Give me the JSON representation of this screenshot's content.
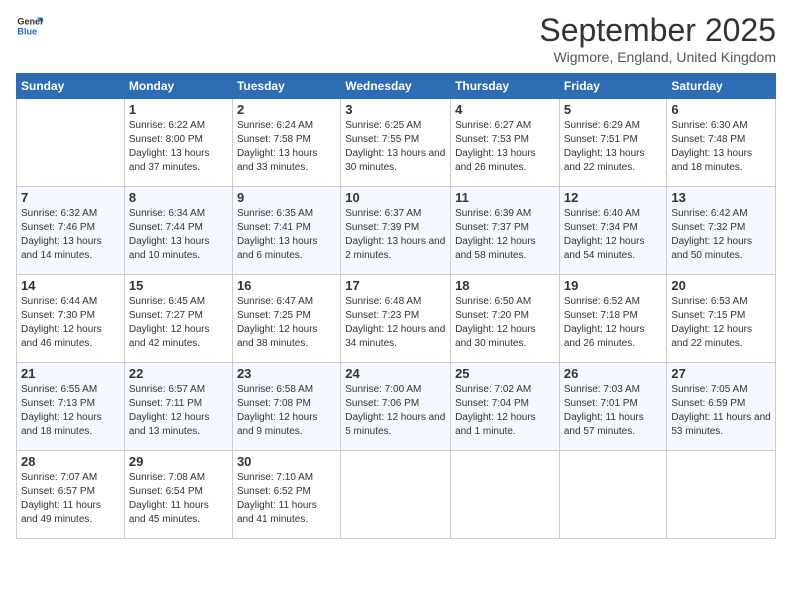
{
  "logo": {
    "line1": "General",
    "line2": "Blue"
  },
  "title": "September 2025",
  "location": "Wigmore, England, United Kingdom",
  "days": [
    "Sunday",
    "Monday",
    "Tuesday",
    "Wednesday",
    "Thursday",
    "Friday",
    "Saturday"
  ],
  "weeks": [
    [
      {
        "date": "",
        "sunrise": "",
        "sunset": "",
        "daylight": ""
      },
      {
        "date": "1",
        "sunrise": "Sunrise: 6:22 AM",
        "sunset": "Sunset: 8:00 PM",
        "daylight": "Daylight: 13 hours and 37 minutes."
      },
      {
        "date": "2",
        "sunrise": "Sunrise: 6:24 AM",
        "sunset": "Sunset: 7:58 PM",
        "daylight": "Daylight: 13 hours and 33 minutes."
      },
      {
        "date": "3",
        "sunrise": "Sunrise: 6:25 AM",
        "sunset": "Sunset: 7:55 PM",
        "daylight": "Daylight: 13 hours and 30 minutes."
      },
      {
        "date": "4",
        "sunrise": "Sunrise: 6:27 AM",
        "sunset": "Sunset: 7:53 PM",
        "daylight": "Daylight: 13 hours and 26 minutes."
      },
      {
        "date": "5",
        "sunrise": "Sunrise: 6:29 AM",
        "sunset": "Sunset: 7:51 PM",
        "daylight": "Daylight: 13 hours and 22 minutes."
      },
      {
        "date": "6",
        "sunrise": "Sunrise: 6:30 AM",
        "sunset": "Sunset: 7:48 PM",
        "daylight": "Daylight: 13 hours and 18 minutes."
      }
    ],
    [
      {
        "date": "7",
        "sunrise": "Sunrise: 6:32 AM",
        "sunset": "Sunset: 7:46 PM",
        "daylight": "Daylight: 13 hours and 14 minutes."
      },
      {
        "date": "8",
        "sunrise": "Sunrise: 6:34 AM",
        "sunset": "Sunset: 7:44 PM",
        "daylight": "Daylight: 13 hours and 10 minutes."
      },
      {
        "date": "9",
        "sunrise": "Sunrise: 6:35 AM",
        "sunset": "Sunset: 7:41 PM",
        "daylight": "Daylight: 13 hours and 6 minutes."
      },
      {
        "date": "10",
        "sunrise": "Sunrise: 6:37 AM",
        "sunset": "Sunset: 7:39 PM",
        "daylight": "Daylight: 13 hours and 2 minutes."
      },
      {
        "date": "11",
        "sunrise": "Sunrise: 6:39 AM",
        "sunset": "Sunset: 7:37 PM",
        "daylight": "Daylight: 12 hours and 58 minutes."
      },
      {
        "date": "12",
        "sunrise": "Sunrise: 6:40 AM",
        "sunset": "Sunset: 7:34 PM",
        "daylight": "Daylight: 12 hours and 54 minutes."
      },
      {
        "date": "13",
        "sunrise": "Sunrise: 6:42 AM",
        "sunset": "Sunset: 7:32 PM",
        "daylight": "Daylight: 12 hours and 50 minutes."
      }
    ],
    [
      {
        "date": "14",
        "sunrise": "Sunrise: 6:44 AM",
        "sunset": "Sunset: 7:30 PM",
        "daylight": "Daylight: 12 hours and 46 minutes."
      },
      {
        "date": "15",
        "sunrise": "Sunrise: 6:45 AM",
        "sunset": "Sunset: 7:27 PM",
        "daylight": "Daylight: 12 hours and 42 minutes."
      },
      {
        "date": "16",
        "sunrise": "Sunrise: 6:47 AM",
        "sunset": "Sunset: 7:25 PM",
        "daylight": "Daylight: 12 hours and 38 minutes."
      },
      {
        "date": "17",
        "sunrise": "Sunrise: 6:48 AM",
        "sunset": "Sunset: 7:23 PM",
        "daylight": "Daylight: 12 hours and 34 minutes."
      },
      {
        "date": "18",
        "sunrise": "Sunrise: 6:50 AM",
        "sunset": "Sunset: 7:20 PM",
        "daylight": "Daylight: 12 hours and 30 minutes."
      },
      {
        "date": "19",
        "sunrise": "Sunrise: 6:52 AM",
        "sunset": "Sunset: 7:18 PM",
        "daylight": "Daylight: 12 hours and 26 minutes."
      },
      {
        "date": "20",
        "sunrise": "Sunrise: 6:53 AM",
        "sunset": "Sunset: 7:15 PM",
        "daylight": "Daylight: 12 hours and 22 minutes."
      }
    ],
    [
      {
        "date": "21",
        "sunrise": "Sunrise: 6:55 AM",
        "sunset": "Sunset: 7:13 PM",
        "daylight": "Daylight: 12 hours and 18 minutes."
      },
      {
        "date": "22",
        "sunrise": "Sunrise: 6:57 AM",
        "sunset": "Sunset: 7:11 PM",
        "daylight": "Daylight: 12 hours and 13 minutes."
      },
      {
        "date": "23",
        "sunrise": "Sunrise: 6:58 AM",
        "sunset": "Sunset: 7:08 PM",
        "daylight": "Daylight: 12 hours and 9 minutes."
      },
      {
        "date": "24",
        "sunrise": "Sunrise: 7:00 AM",
        "sunset": "Sunset: 7:06 PM",
        "daylight": "Daylight: 12 hours and 5 minutes."
      },
      {
        "date": "25",
        "sunrise": "Sunrise: 7:02 AM",
        "sunset": "Sunset: 7:04 PM",
        "daylight": "Daylight: 12 hours and 1 minute."
      },
      {
        "date": "26",
        "sunrise": "Sunrise: 7:03 AM",
        "sunset": "Sunset: 7:01 PM",
        "daylight": "Daylight: 11 hours and 57 minutes."
      },
      {
        "date": "27",
        "sunrise": "Sunrise: 7:05 AM",
        "sunset": "Sunset: 6:59 PM",
        "daylight": "Daylight: 11 hours and 53 minutes."
      }
    ],
    [
      {
        "date": "28",
        "sunrise": "Sunrise: 7:07 AM",
        "sunset": "Sunset: 6:57 PM",
        "daylight": "Daylight: 11 hours and 49 minutes."
      },
      {
        "date": "29",
        "sunrise": "Sunrise: 7:08 AM",
        "sunset": "Sunset: 6:54 PM",
        "daylight": "Daylight: 11 hours and 45 minutes."
      },
      {
        "date": "30",
        "sunrise": "Sunrise: 7:10 AM",
        "sunset": "Sunset: 6:52 PM",
        "daylight": "Daylight: 11 hours and 41 minutes."
      },
      {
        "date": "",
        "sunrise": "",
        "sunset": "",
        "daylight": ""
      },
      {
        "date": "",
        "sunrise": "",
        "sunset": "",
        "daylight": ""
      },
      {
        "date": "",
        "sunrise": "",
        "sunset": "",
        "daylight": ""
      },
      {
        "date": "",
        "sunrise": "",
        "sunset": "",
        "daylight": ""
      }
    ]
  ]
}
